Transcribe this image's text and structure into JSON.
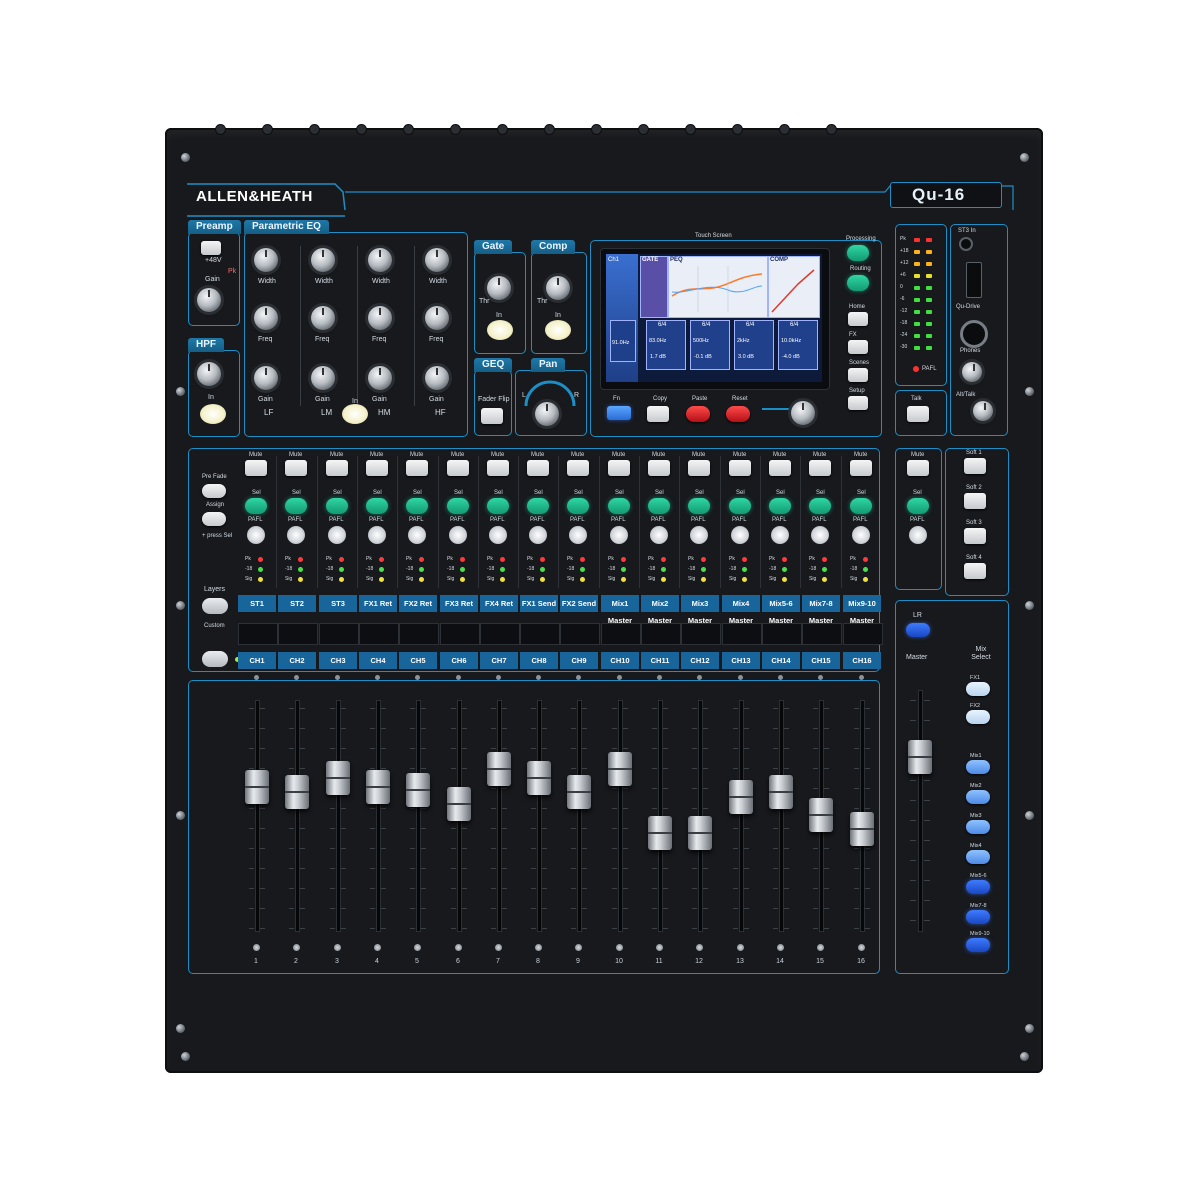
{
  "brand": {
    "name": "ALLEN&HEATH",
    "model": "Qu-16"
  },
  "colors": {
    "accent": "#1d8fc7",
    "label_bar": "#17659a",
    "green": "#1fbf8e",
    "red": "#e02b2b",
    "blue": "#2f68f0"
  },
  "sections": {
    "preamp": "Preamp",
    "peq": "Parametric EQ",
    "hpf": "HPF",
    "gate": "Gate",
    "comp": "Comp",
    "geq": "GEQ",
    "pan": "Pan",
    "touch_screen": "Touch Screen",
    "processing": "Processing",
    "routing": "Routing"
  },
  "preamp": {
    "plus48": "+48V",
    "gain": "Gain",
    "pk": "Pk"
  },
  "peq_rows": [
    "Width",
    "Freq",
    "Gain"
  ],
  "peq_bands": [
    "LF",
    "LM",
    "HM",
    "HF"
  ],
  "in_label": "In",
  "gate": {
    "thr": "Thr",
    "in": "In"
  },
  "comp": {
    "thr": "Thr",
    "in": "In"
  },
  "geq": {
    "fader_flip": "Fader Flip"
  },
  "pan": {
    "l": "L",
    "r": "R"
  },
  "screen": {
    "tabs": [
      "Ch1",
      "GATE",
      "PEQ",
      "COMP"
    ],
    "cells": [
      "6/4",
      "6/4",
      "6/4",
      "6/4",
      "6/4"
    ],
    "values_a": [
      "83.0Hz",
      "500Hz",
      "2kHz",
      "10.0kHz"
    ],
    "values_b": [
      "1.7 dB",
      "-0.1 dB",
      "3.0 dB",
      "-4.0 dB"
    ],
    "freq": "91.0Hz"
  },
  "screen_buttons": [
    "Fn",
    "Copy",
    "Paste",
    "Reset"
  ],
  "side_buttons": [
    "Home",
    "FX",
    "Scenes",
    "Setup"
  ],
  "meter": {
    "labels": [
      "Pk",
      "+18",
      "+12",
      "+6",
      "0",
      "-6",
      "-12",
      "-18",
      "-24",
      "-30"
    ],
    "pafl": "PAFL"
  },
  "usb": {
    "st3in": "ST3 In",
    "qu_drive": "Qu-Drive",
    "phones": "Phones",
    "talk": "Talk",
    "alt_talk": "Alt/Talk"
  },
  "strip": {
    "mute": "Mute",
    "sel": "Sel",
    "pafl": "PAFL",
    "pk": "Pk",
    "minus18": "-18",
    "sig": "Sig"
  },
  "assign": {
    "pre_fade": "Pre Fade",
    "assign": "Assign",
    "press_sel": "+ press Sel"
  },
  "layers": {
    "title": "Layers",
    "custom": "Custom"
  },
  "top_layer": [
    "ST1",
    "ST2",
    "ST3",
    "FX1 Ret",
    "FX2 Ret",
    "FX3 Ret",
    "FX4 Ret",
    "FX1 Send",
    "FX2 Send",
    "Mix1 Master",
    "Mix2 Master",
    "Mix3 Master",
    "Mix4 Master",
    "Mix5-6 Master",
    "Mix7-8 Master",
    "Mix9-10 Master"
  ],
  "bottom_layer": [
    "CH1",
    "CH2",
    "CH3",
    "CH4",
    "CH5",
    "CH6",
    "CH7",
    "CH8",
    "CH9",
    "CH10",
    "CH11",
    "CH12",
    "CH13",
    "CH14",
    "CH15",
    "CH16"
  ],
  "channel_numbers": [
    "1",
    "2",
    "3",
    "4",
    "5",
    "6",
    "7",
    "8",
    "9",
    "10",
    "11",
    "12",
    "13",
    "14",
    "15",
    "16"
  ],
  "soft_keys": [
    "Soft 1",
    "Soft 2",
    "Soft 3",
    "Soft 4"
  ],
  "master": {
    "lr": "LR",
    "master": "Master",
    "mix_select": "Mix Select",
    "mix_buttons": [
      "FX1",
      "FX2",
      "Mix1",
      "Mix2",
      "Mix3",
      "Mix4",
      "Mix5-6",
      "Mix7-8",
      "Mix9-10"
    ]
  },
  "fader_positions": [
    0.62,
    0.6,
    0.66,
    0.62,
    0.61,
    0.55,
    0.7,
    0.66,
    0.6,
    0.7,
    0.42,
    0.42,
    0.58,
    0.6,
    0.5,
    0.44
  ],
  "master_fader_position": 0.72
}
